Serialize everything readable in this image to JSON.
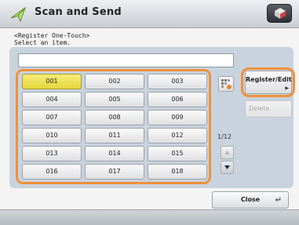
{
  "header": {
    "title": "Scan and Send"
  },
  "instruction": {
    "line1": "<Register One-Touch>",
    "line2": "Select an item."
  },
  "name_field": {
    "value": ""
  },
  "grid": {
    "buttons": [
      "001",
      "002",
      "003",
      "004",
      "005",
      "006",
      "007",
      "008",
      "009",
      "010",
      "011",
      "012",
      "013",
      "014",
      "015",
      "016",
      "017",
      "018"
    ],
    "selected": "001"
  },
  "pager": {
    "indicator": "1/12"
  },
  "side": {
    "register_label": "Register/Edit",
    "delete_label": "Delete"
  },
  "footer_bar": {
    "close_label": "Close"
  },
  "colors": {
    "highlight": "#f0913a",
    "selected": "#eadf4d",
    "panel": "#c8d3de"
  }
}
